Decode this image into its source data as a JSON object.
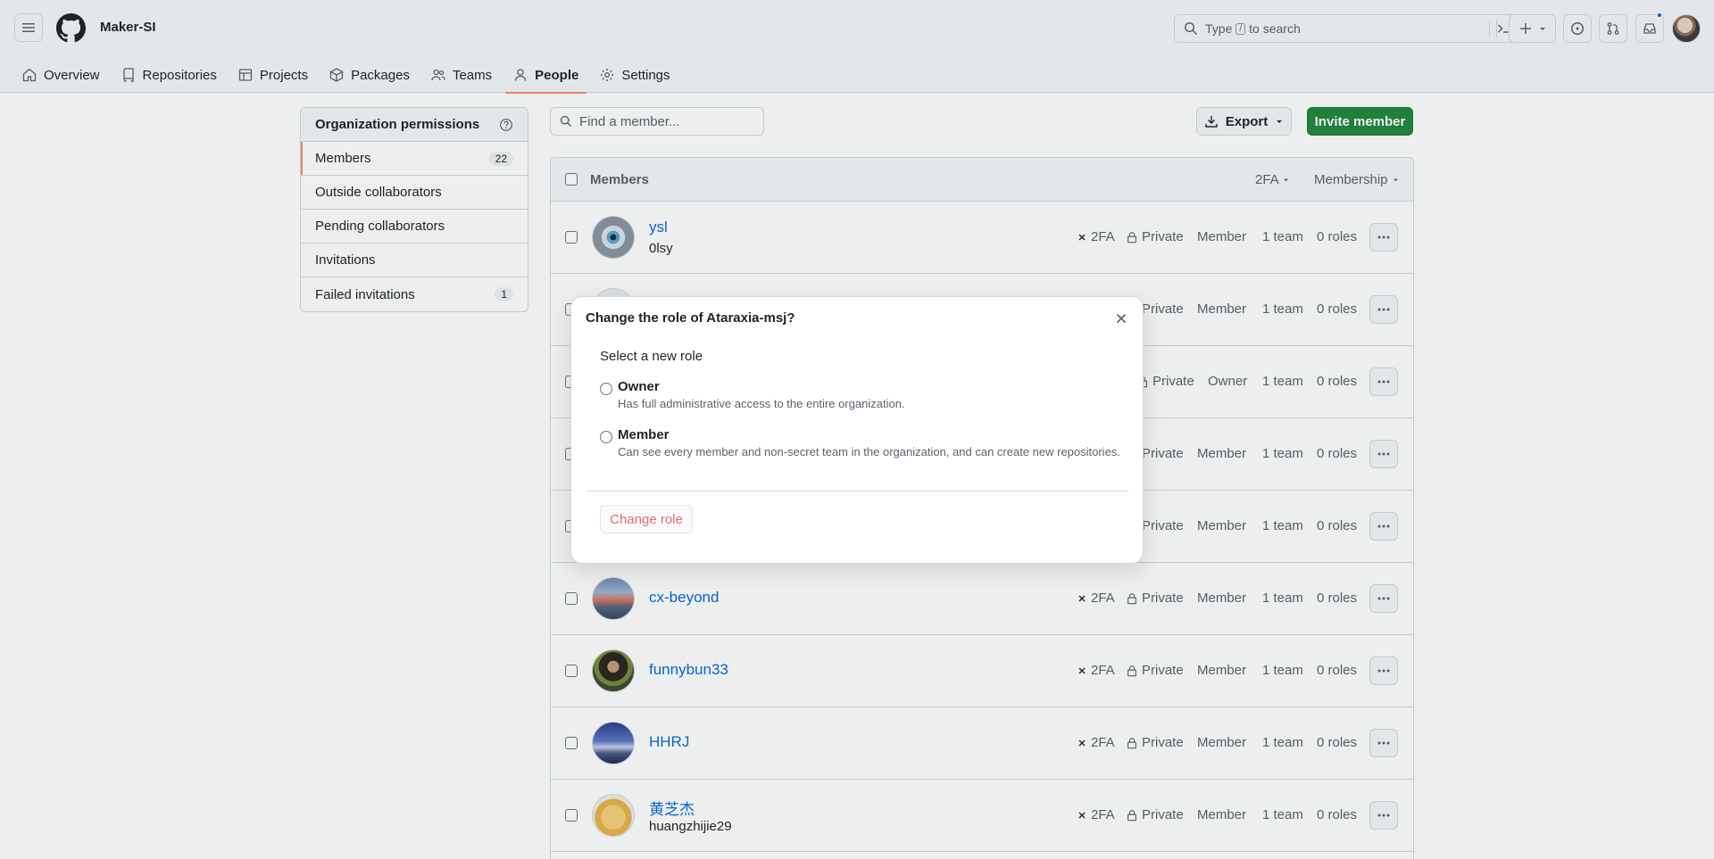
{
  "header": {
    "org_name": "Maker-SI",
    "search_placeholder_pre": "Type",
    "search_key": "/",
    "search_placeholder_post": "to search",
    "icons": [
      "hamburger-icon",
      "github-logo",
      "terminal-icon",
      "plus-icon",
      "issue-icon",
      "pull-request-icon",
      "inbox-icon"
    ],
    "notification_dot_color": "#0969da"
  },
  "tabs": [
    {
      "label": "Overview",
      "icon": "home-icon"
    },
    {
      "label": "Repositories",
      "icon": "repo-icon"
    },
    {
      "label": "Projects",
      "icon": "table-icon"
    },
    {
      "label": "Packages",
      "icon": "package-icon"
    },
    {
      "label": "Teams",
      "icon": "people-icon"
    },
    {
      "label": "People",
      "icon": "person-icon",
      "active": true
    },
    {
      "label": "Settings",
      "icon": "gear-icon"
    }
  ],
  "sidebar": {
    "heading": "Organization permissions",
    "items": [
      {
        "label": "Members",
        "count": "22",
        "active": true
      },
      {
        "label": "Outside collaborators"
      },
      {
        "label": "Pending collaborators"
      },
      {
        "label": "Invitations"
      },
      {
        "label": "Failed invitations",
        "count": "1"
      }
    ]
  },
  "toolbar": {
    "find_placeholder": "Find a member...",
    "export_label": "Export",
    "invite_label": "Invite member"
  },
  "table": {
    "header_title": "Members",
    "filter_2fa": "2FA",
    "filter_membership": "Membership",
    "rows": [
      {
        "login": "ysl",
        "name": "0lsy",
        "twofa": "2FA",
        "visibility": "Private",
        "role": "Member",
        "teams": "1 team",
        "roles": "0 roles"
      },
      {
        "login": "",
        "name": "",
        "twofa": "",
        "visibility": "Private",
        "role": "Member",
        "teams": "1 team",
        "roles": "0 roles"
      },
      {
        "login": "",
        "name": "",
        "twofa": "",
        "visibility": "Private",
        "role": "Owner",
        "teams": "1 team",
        "roles": "0 roles"
      },
      {
        "login": "",
        "name": "",
        "twofa": "",
        "visibility": "Private",
        "role": "Member",
        "teams": "1 team",
        "roles": "0 roles"
      },
      {
        "login": "",
        "name": "",
        "twofa": "",
        "visibility": "Private",
        "role": "Member",
        "teams": "1 team",
        "roles": "0 roles"
      },
      {
        "login": "cx-beyond",
        "name": "",
        "twofa": "2FA",
        "visibility": "Private",
        "role": "Member",
        "teams": "1 team",
        "roles": "0 roles"
      },
      {
        "login": "funnybun33",
        "name": "",
        "twofa": "2FA",
        "visibility": "Private",
        "role": "Member",
        "teams": "1 team",
        "roles": "0 roles"
      },
      {
        "login": "HHRJ",
        "name": "",
        "twofa": "2FA",
        "visibility": "Private",
        "role": "Member",
        "teams": "1 team",
        "roles": "0 roles"
      },
      {
        "login": "黄芝杰",
        "name": "huangzhijie29",
        "twofa": "2FA",
        "visibility": "Private",
        "role": "Member",
        "teams": "1 team",
        "roles": "0 roles"
      }
    ]
  },
  "dialog": {
    "title": "Change the role of Ataraxia-msj?",
    "legend": "Select a new role",
    "options": [
      {
        "label": "Owner",
        "description": "Has full administrative access to the entire organization."
      },
      {
        "label": "Member",
        "description": "Can see every member and non-secret team in the organization, and can create new repositories."
      }
    ],
    "submit_label": "Change role"
  },
  "colors": {
    "accent_underline": "#fd8c73",
    "primary_button": "#1f883d",
    "link": "#0969da",
    "danger": "#d1242f"
  }
}
